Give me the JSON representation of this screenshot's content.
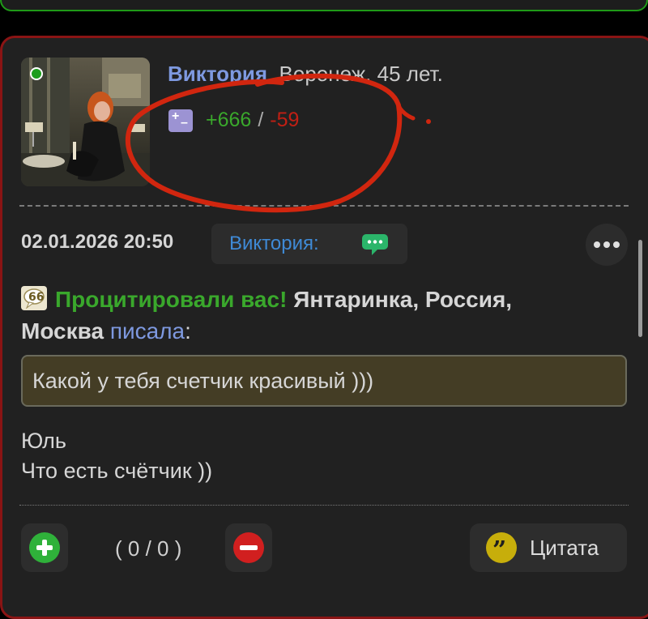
{
  "profile": {
    "name": "Виктория",
    "meta": ", Воронеж, 45 лет.",
    "rating_plus": "+666",
    "rating_separator": "/",
    "rating_minus": "-59",
    "online": true
  },
  "post": {
    "date": "02.01.2026 20:50",
    "author_chip": "Виктория:",
    "quote_badge": "Процитировали вас!",
    "quoted_author_line1": "Янтаринка, Россия,",
    "quoted_author_line2": "Москва",
    "wrote": "писала",
    "colon": ":",
    "quote_text": "Какой у тебя счетчик красивый )))",
    "body_lines": [
      "Юль",
      "Что есть счётчик ))"
    ]
  },
  "actions": {
    "vote_count": "( 0 / 0 )",
    "cite_label": "Цитата"
  },
  "icons": {
    "rating": "plus-minus-icon",
    "chat": "chat-bubble-icon",
    "more": "more-dots-icon",
    "quote": "quote-icon",
    "upvote": "plus-circle-icon",
    "downvote": "minus-circle-icon",
    "cite": "cite-quote-icon"
  },
  "colors": {
    "name": "#7e99e0",
    "rating_plus": "#3aa82c",
    "rating_minus": "#c11f14",
    "post_border": "#8a1414",
    "top_border": "#1f9a18",
    "quote_bg": "#443d25",
    "author_chip_text": "#3f8ad6",
    "upvote": "#2fb13a",
    "downvote": "#d11f1f",
    "cite": "#c7ae0b"
  }
}
